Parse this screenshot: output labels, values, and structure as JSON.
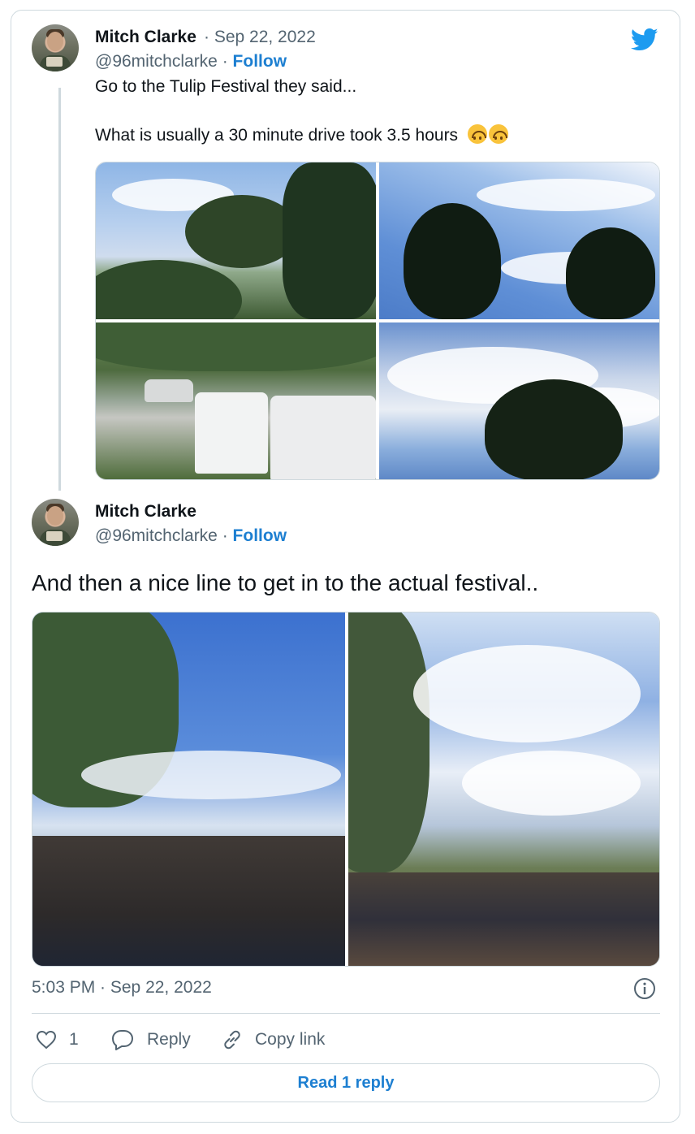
{
  "tweet1": {
    "author_name": "Mitch Clarke",
    "date": "Sep 22, 2022",
    "handle": "@96mitchclarke",
    "follow_label": "Follow",
    "line1": "Go to the Tulip Festival they said...",
    "line2": "What is usually a 30 minute drive took 3.5 hours",
    "emoji": [
      "upside-down-face",
      "upside-down-face"
    ],
    "photos": 4
  },
  "tweet2": {
    "author_name": "Mitch Clarke",
    "handle": "@96mitchclarke",
    "follow_label": "Follow",
    "text": "And then a nice line to get in to the actual festival..",
    "photos": 2,
    "timestamp": "5:03 PM · Sep 22, 2022"
  },
  "actions": {
    "like_count": "1",
    "reply_label": "Reply",
    "copy_label": "Copy link"
  },
  "read_replies_label": "Read 1 reply",
  "icons": [
    "twitter-bird-icon",
    "info-icon",
    "heart-icon",
    "reply-bubble-icon",
    "link-icon"
  ],
  "colors": {
    "accent": "#1d7fd1",
    "twitter_blue": "#1d9bf0",
    "muted": "#536471",
    "border": "#cfd9de"
  }
}
